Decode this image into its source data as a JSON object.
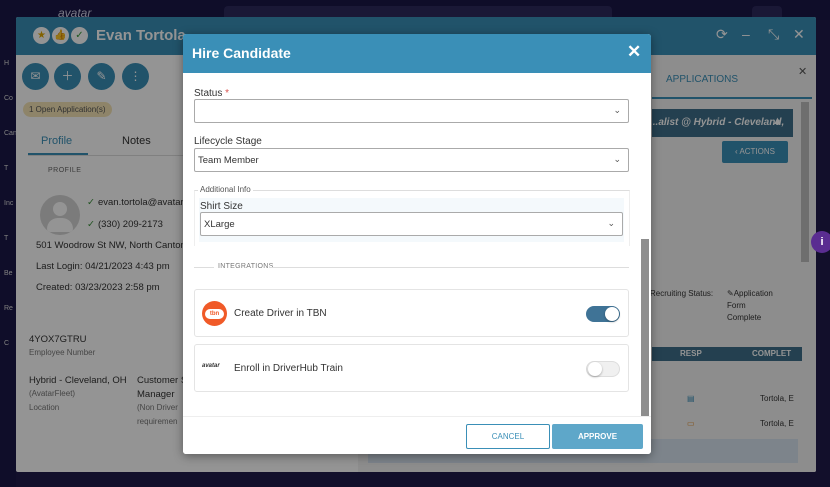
{
  "app": {
    "logo": "avatar"
  },
  "left_nav": [
    "H",
    "Co",
    "Can",
    "T",
    "Inc",
    "T",
    "Be",
    "Re",
    "C"
  ],
  "profile": {
    "name": "Evan Tortola",
    "open_applications": "1 Open Application(s)",
    "tabs": [
      "Profile",
      "Notes"
    ],
    "section_label": "PROFILE",
    "email": "evan.tortola@avatar",
    "phone": "(330) 209-2173",
    "address": "501 Woodrow St NW, North Canton",
    "last_login": "Last Login: 04/21/2023 4:43 pm",
    "created": "Created: 03/23/2023 2:58 pm",
    "employee_number": "4YOX7GTRU",
    "employee_number_label": "Employee Number",
    "location_value": "Hybrid - Cleveland, OH",
    "location_sub": "(AvatarFleet)",
    "location_label": "Location",
    "role_value_1": "Customer S",
    "role_value_2": "Manager",
    "role_sub_1": "(Non Driver",
    "role_sub_2": "requiremen"
  },
  "applications": {
    "tab": "APPLICATIONS",
    "job": "...alist @ Hybrid - Cleveland,",
    "actions": "ACTIONS",
    "recruiting_status_label": "Recruiting Status:",
    "status_1": "Application",
    "status_2": "Form",
    "status_3": "Complete",
    "col_resp": "RESP",
    "col_complete": "COMPLET",
    "row_1": "Tortola, E",
    "row_2": "Tortola, E"
  },
  "modal": {
    "title": "Hire Candidate",
    "status_label": "Status",
    "required_mark": "*",
    "status_value": "",
    "lifecycle_label": "Lifecycle Stage",
    "lifecycle_value": "Team Member",
    "additional_info": "Additional Info",
    "shirt_label": "Shirt Size",
    "shirt_value": "XLarge",
    "integrations_label": "INTEGRATIONS",
    "integrations": [
      {
        "label": "Create Driver in TBN",
        "enabled": true,
        "icon": "tbn-logo"
      },
      {
        "label": "Enroll in DriverHub Train",
        "enabled": false,
        "icon": "avatar-logo",
        "logo_text": "avatar"
      }
    ],
    "cancel": "CANCEL",
    "approve": "APPROVE"
  },
  "colors": {
    "primary": "#3a8fb7",
    "header_dark": "#3f6f8a",
    "toggle_on": "#3f7396",
    "tbn": "#f05a28",
    "info": "#5a2d91"
  }
}
